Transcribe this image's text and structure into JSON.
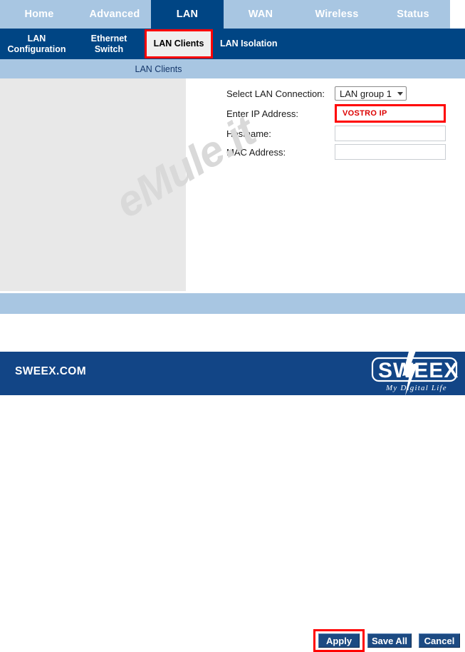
{
  "topnav": {
    "items": [
      {
        "label": "Home",
        "active": false
      },
      {
        "label": "Advanced",
        "active": false
      },
      {
        "label": "LAN",
        "active": true
      },
      {
        "label": "WAN",
        "active": false
      },
      {
        "label": "Wireless",
        "active": false
      },
      {
        "label": "Status",
        "active": false
      }
    ]
  },
  "subnav": {
    "items": [
      {
        "label": "LAN Configuration",
        "selected": false
      },
      {
        "label": "Ethernet Switch",
        "selected": false
      },
      {
        "label": "LAN Clients",
        "selected": true
      },
      {
        "label": "LAN Isolation",
        "selected": false
      }
    ]
  },
  "breadcrumb": {
    "text": "LAN Clients"
  },
  "form": {
    "lan_connection": {
      "label": "Select LAN Connection:",
      "value": "LAN group 1",
      "options": [
        "LAN group 1"
      ]
    },
    "ip_address": {
      "label": "Enter IP Address:",
      "value": "VOSTRO IP",
      "placeholder": ""
    },
    "hostname": {
      "label": "Hostname:",
      "value": "",
      "placeholder": ""
    },
    "mac_address": {
      "label": "MAC Address:",
      "value": "",
      "placeholder": ""
    }
  },
  "watermark": {
    "text": "eMule.it"
  },
  "buttons": {
    "apply": "Apply",
    "save_all": "Save All",
    "cancel": "Cancel"
  },
  "footer": {
    "brand": "SWEEX.COM",
    "logo_text": "SWEEX",
    "logo_tagline": "My Digital Life"
  },
  "colors": {
    "nav_light_blue": "#a8c6e2",
    "nav_dark_blue": "#004584",
    "footer_blue": "#124586",
    "button_blue": "#1c4a82",
    "highlight_red": "#ff0000",
    "panel_gray": "#e8e8e8",
    "watermark_gray": "#d9d9d9"
  }
}
